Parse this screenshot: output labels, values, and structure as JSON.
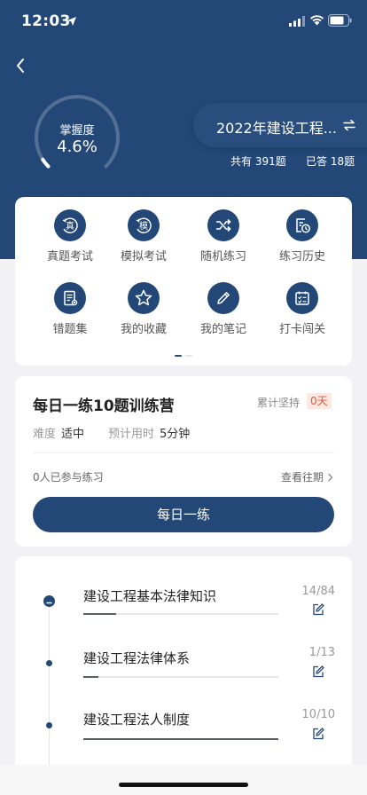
{
  "status_bar": {
    "time": "12:03"
  },
  "mastery": {
    "label": "掌握度",
    "value": "4.6%",
    "fraction": 0.046
  },
  "exam": {
    "title": "2022年建设工程...",
    "total": "共有 391题",
    "answered": "已答 18题"
  },
  "grid": [
    {
      "label": "真题考试",
      "icon": "zhen-icon",
      "glyph": "真"
    },
    {
      "label": "模拟考试",
      "icon": "mo-icon",
      "glyph": "模"
    },
    {
      "label": "随机练习",
      "icon": "shuffle-icon"
    },
    {
      "label": "练习历史",
      "icon": "history-icon"
    },
    {
      "label": "错题集",
      "icon": "wrong-notes-icon"
    },
    {
      "label": "我的收藏",
      "icon": "star-icon"
    },
    {
      "label": "我的笔记",
      "icon": "pencil-icon"
    },
    {
      "label": "打卡闯关",
      "icon": "checkin-calendar-icon"
    }
  ],
  "daily": {
    "title": "每日一练10题训练营",
    "keep_label": "累计坚持",
    "keep_value": "0天",
    "difficulty_label": "难度",
    "difficulty_value": "适中",
    "time_label": "预计用时",
    "time_value": "5分钟",
    "participants": "0人已参与练习",
    "history_link": "查看往期",
    "button": "每日一练"
  },
  "chapters": [
    {
      "title": "建设工程基本法律知识",
      "count": "14/84",
      "progress": 0.1667
    },
    {
      "title": "建设工程法律体系",
      "count": "1/13",
      "progress": 0.0769
    },
    {
      "title": "建设工程法人制度",
      "count": "10/10",
      "progress": 1.0
    }
  ],
  "colors": {
    "primary": "#234877",
    "badge_bg": "#fde8e2",
    "badge_text": "#e8543b"
  }
}
